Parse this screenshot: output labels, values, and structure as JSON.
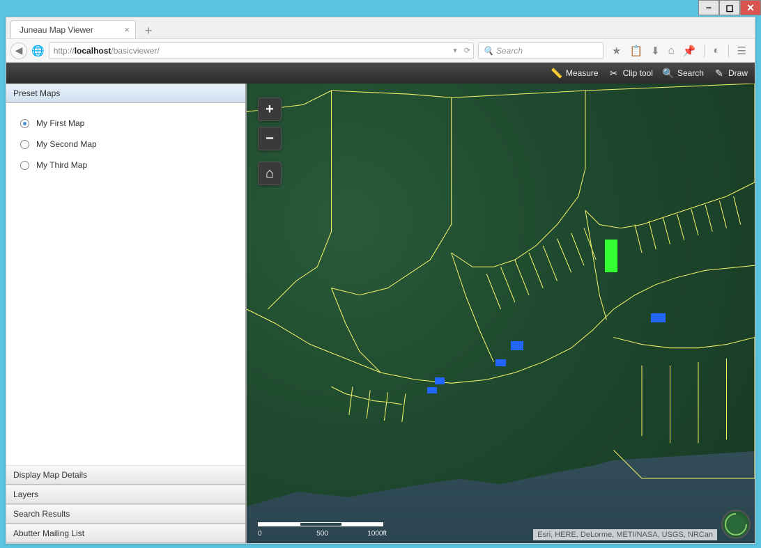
{
  "window": {
    "min": "−",
    "max": "◻",
    "close": "✕"
  },
  "browser": {
    "tab_title": "Juneau Map Viewer",
    "url_prefix": "http://",
    "url_host": "localhost",
    "url_path": "/basicviewer/",
    "search_placeholder": "Search",
    "dropdown_glyph": "▾",
    "reload_glyph": "⟳"
  },
  "toolbar": {
    "measure": "Measure",
    "clip": "Clip tool",
    "search": "Search",
    "draw": "Draw"
  },
  "sidebar": {
    "preset_header": "Preset Maps",
    "presets": [
      {
        "label": "My First Map",
        "selected": true
      },
      {
        "label": "My Second Map",
        "selected": false
      },
      {
        "label": "My Third Map",
        "selected": false
      }
    ],
    "panels": {
      "details": "Display Map Details",
      "layers": "Layers",
      "results": "Search Results",
      "abutter": "Abutter Mailing List"
    }
  },
  "map": {
    "zoom_in": "+",
    "zoom_out": "−",
    "home": "⌂",
    "scale": {
      "t0": "0",
      "t1": "500",
      "t2": "1000ft"
    },
    "attribution": "Esri, HERE, DeLorme, METI/NASA, USGS, NRCan"
  }
}
